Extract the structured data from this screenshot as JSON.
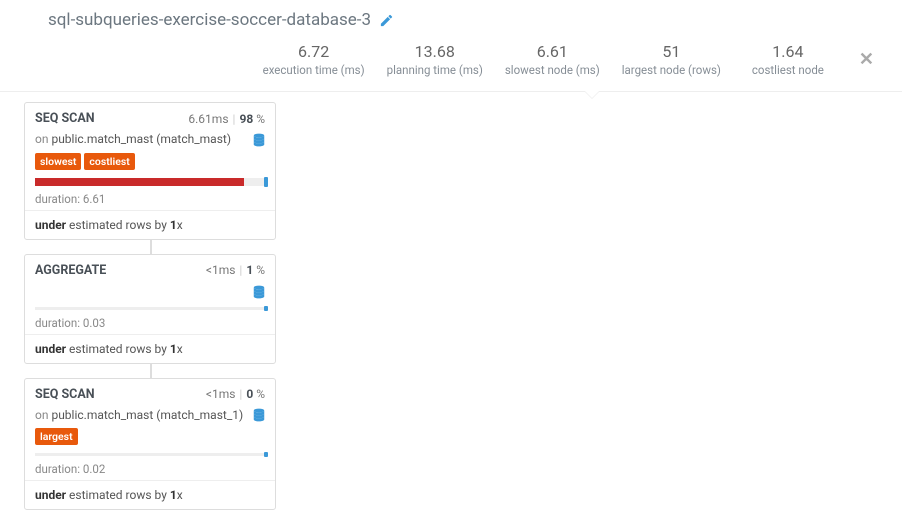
{
  "title": "sql-subqueries-exercise-soccer-database-3",
  "stats": [
    {
      "value": "6.72",
      "label": "execution time (ms)"
    },
    {
      "value": "13.68",
      "label": "planning time (ms)"
    },
    {
      "value": "6.61",
      "label": "slowest node (ms)"
    },
    {
      "value": "51",
      "label": "largest node (rows)"
    },
    {
      "value": "1.64",
      "label": "costliest node"
    }
  ],
  "nodes": [
    {
      "op": "SEQ SCAN",
      "time": "6.61",
      "time_unit": "ms",
      "pct": "98",
      "on_label": "on ",
      "target": "public.match_mast (match_mast)",
      "has_target": true,
      "badges": [
        "slowest",
        "costliest"
      ],
      "bar_fill_pct": 91,
      "bar_thin": false,
      "duration_label": "duration: ",
      "duration": "6.61",
      "est_prefix": "under",
      "est_mid": " estimated rows by ",
      "est_x": "1",
      "est_suffix": "x"
    },
    {
      "op": "AGGREGATE",
      "time": "<1",
      "time_unit": "ms",
      "pct": "1",
      "on_label": "",
      "target": "",
      "has_target": false,
      "badges": [],
      "bar_fill_pct": 0,
      "bar_thin": true,
      "duration_label": "duration: ",
      "duration": "0.03",
      "est_prefix": "under",
      "est_mid": " estimated rows by ",
      "est_x": "1",
      "est_suffix": "x"
    },
    {
      "op": "SEQ SCAN",
      "time": "<1",
      "time_unit": "ms",
      "pct": "0",
      "on_label": "on ",
      "target": "public.match_mast (match_mast_1)",
      "has_target": true,
      "badges": [
        "largest"
      ],
      "bar_fill_pct": 0,
      "bar_thin": true,
      "duration_label": "duration: ",
      "duration": "0.02",
      "est_prefix": "under",
      "est_mid": " estimated rows by ",
      "est_x": "1",
      "est_suffix": "x"
    }
  ],
  "icons": {
    "sep": "|",
    "pct_sign": " %"
  }
}
